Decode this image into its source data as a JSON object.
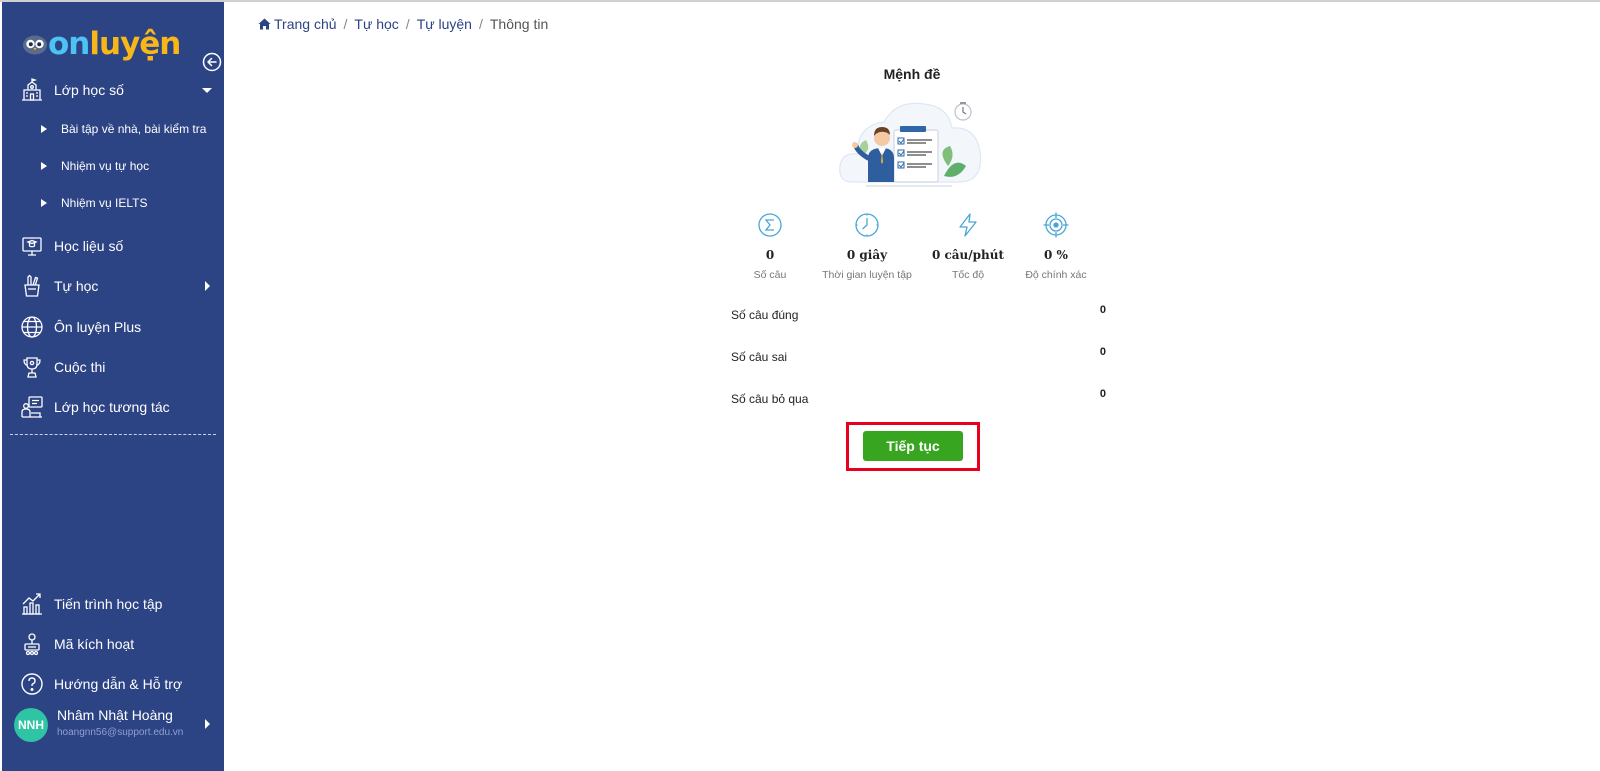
{
  "app": {
    "logo_text_on": "on",
    "logo_text_luyen": "luyện",
    "colors": {
      "sidebar": "#2c4384",
      "accent_green": "#38a521",
      "highlight_red": "#e8001c",
      "avatar": "#2fc4a3"
    }
  },
  "sidebar": {
    "collapse_icon": "arrow-left-circle-icon",
    "items": [
      {
        "label": "Lớp học số",
        "icon": "school-building-icon",
        "expanded": true
      },
      {
        "label": "Bài tập về nhà, bài kiểm tra"
      },
      {
        "label": "Nhiệm vụ tự học"
      },
      {
        "label": "Nhiệm vụ IELTS"
      },
      {
        "label": "Học liệu số",
        "icon": "digital-material-icon"
      },
      {
        "label": "Tự học",
        "icon": "pencil-cup-icon"
      },
      {
        "label": "Ôn luyện Plus",
        "icon": "globe-icon"
      },
      {
        "label": "Cuộc thi",
        "icon": "trophy-icon"
      },
      {
        "label": "Lớp học tương tác",
        "icon": "interactive-class-icon"
      }
    ],
    "bottom_items": [
      {
        "label": "Tiến trình học tập",
        "icon": "progress-chart-icon"
      },
      {
        "label": "Mã kích hoạt",
        "icon": "activation-code-icon"
      },
      {
        "label": "Hướng dẫn & Hỗ trợ",
        "icon": "help-circle-icon"
      }
    ],
    "user": {
      "initials": "NNH",
      "name": "Nhâm Nhật Hoàng",
      "email": "hoangnn56@support.edu.vn"
    }
  },
  "breadcrumb": {
    "items": [
      "Trang chủ",
      "Tự học",
      "Tự luyện"
    ],
    "current": "Thông tin",
    "separator": "/"
  },
  "main": {
    "title": "Mệnh đề",
    "stats": [
      {
        "value": "0",
        "caption": "Số câu",
        "icon": "sigma-icon"
      },
      {
        "value": "0 giây",
        "caption": "Thời gian luyện tập",
        "icon": "clock-icon"
      },
      {
        "value": "0 câu/phút",
        "caption": "Tốc độ",
        "icon": "lightning-icon"
      },
      {
        "value": "0 %",
        "caption": "Độ chính xác",
        "icon": "target-icon"
      }
    ],
    "results": [
      {
        "label": "Số câu đúng",
        "value": "0"
      },
      {
        "label": "Số câu sai",
        "value": "0"
      },
      {
        "label": "Số câu bỏ qua",
        "value": "0"
      }
    ],
    "continue_label": "Tiếp tục"
  }
}
